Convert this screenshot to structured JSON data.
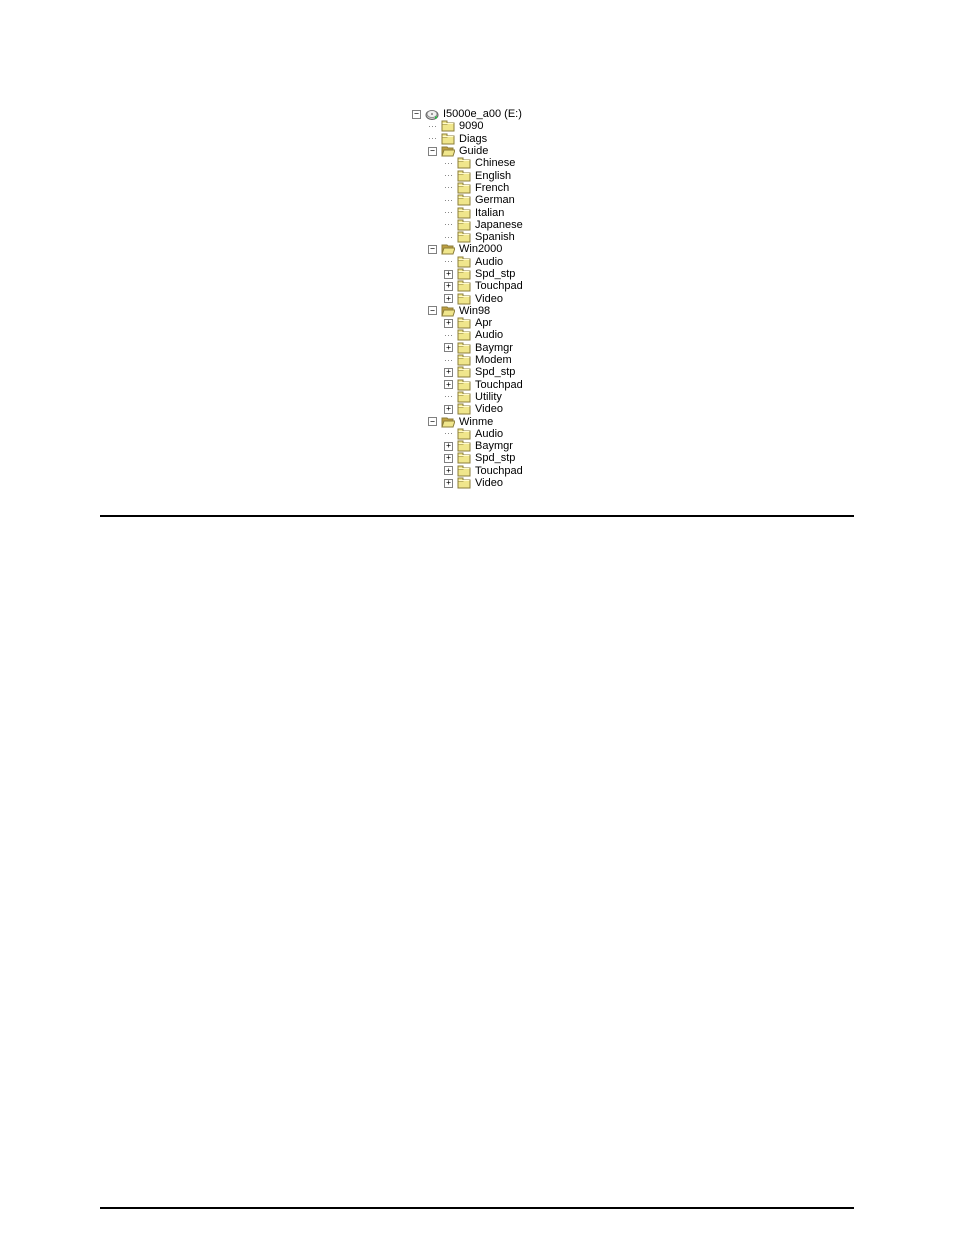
{
  "tree": {
    "root": {
      "label": "I5000e_a00 (E:)",
      "icon": "drive",
      "expander": "minus",
      "children": [
        {
          "label": "9090",
          "icon": "folder-closed",
          "expander": "none"
        },
        {
          "label": "Diags",
          "icon": "folder-closed",
          "expander": "none"
        },
        {
          "label": "Guide",
          "icon": "folder-open",
          "expander": "minus",
          "children": [
            {
              "label": "Chinese",
              "icon": "folder-closed",
              "expander": "none"
            },
            {
              "label": "English",
              "icon": "folder-closed",
              "expander": "none"
            },
            {
              "label": "French",
              "icon": "folder-closed",
              "expander": "none"
            },
            {
              "label": "German",
              "icon": "folder-closed",
              "expander": "none"
            },
            {
              "label": "Italian",
              "icon": "folder-closed",
              "expander": "none"
            },
            {
              "label": "Japanese",
              "icon": "folder-closed",
              "expander": "none"
            },
            {
              "label": "Spanish",
              "icon": "folder-closed",
              "expander": "none"
            }
          ]
        },
        {
          "label": "Win2000",
          "icon": "folder-open",
          "expander": "minus",
          "children": [
            {
              "label": "Audio",
              "icon": "folder-closed",
              "expander": "none"
            },
            {
              "label": "Spd_stp",
              "icon": "folder-closed",
              "expander": "plus"
            },
            {
              "label": "Touchpad",
              "icon": "folder-closed",
              "expander": "plus"
            },
            {
              "label": "Video",
              "icon": "folder-closed",
              "expander": "plus"
            }
          ]
        },
        {
          "label": "Win98",
          "icon": "folder-open",
          "expander": "minus",
          "children": [
            {
              "label": "Apr",
              "icon": "folder-closed",
              "expander": "plus"
            },
            {
              "label": "Audio",
              "icon": "folder-closed",
              "expander": "none"
            },
            {
              "label": "Baymgr",
              "icon": "folder-closed",
              "expander": "plus"
            },
            {
              "label": "Modem",
              "icon": "folder-closed",
              "expander": "none"
            },
            {
              "label": "Spd_stp",
              "icon": "folder-closed",
              "expander": "plus"
            },
            {
              "label": "Touchpad",
              "icon": "folder-closed",
              "expander": "plus"
            },
            {
              "label": "Utility",
              "icon": "folder-closed",
              "expander": "none"
            },
            {
              "label": "Video",
              "icon": "folder-closed",
              "expander": "plus"
            }
          ]
        },
        {
          "label": "Winme",
          "icon": "folder-open",
          "expander": "minus",
          "children": [
            {
              "label": "Audio",
              "icon": "folder-closed",
              "expander": "none"
            },
            {
              "label": "Baymgr",
              "icon": "folder-closed",
              "expander": "plus"
            },
            {
              "label": "Spd_stp",
              "icon": "folder-closed",
              "expander": "plus"
            },
            {
              "label": "Touchpad",
              "icon": "folder-closed",
              "expander": "plus"
            },
            {
              "label": "Video",
              "icon": "folder-closed",
              "expander": "plus"
            }
          ]
        }
      ]
    }
  }
}
